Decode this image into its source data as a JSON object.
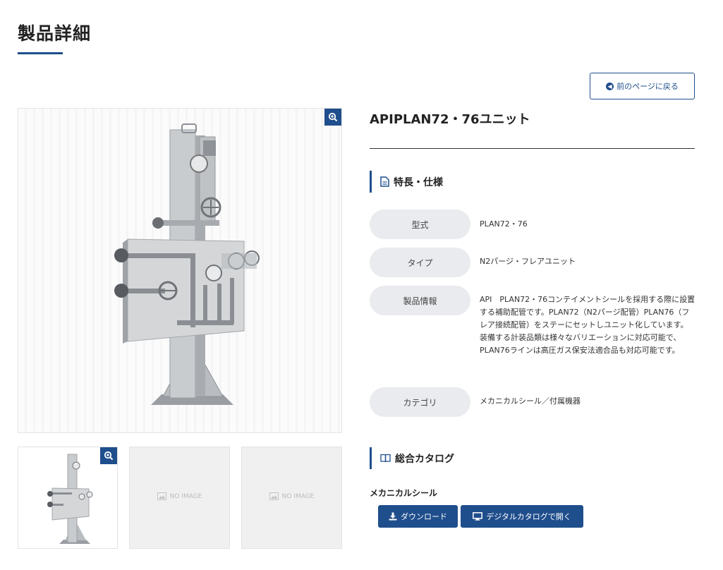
{
  "page": {
    "title": "製品詳細"
  },
  "back_button": {
    "label": "前のページに戻る"
  },
  "product": {
    "name": "APIPLAN72・76ユニット"
  },
  "thumbnails": {
    "no_image_label": "NO IMAGE"
  },
  "spec_section": {
    "heading": "特長・仕様",
    "rows": [
      {
        "label": "型式",
        "value": "PLAN72・76"
      },
      {
        "label": "タイプ",
        "value": "N2パージ・フレアユニット"
      },
      {
        "label": "製品情報",
        "value": "API　PLAN72・76コンテイメントシールを採用する際に設置する補助配管です。PLAN72（N2パージ配管）PLAN76（フレア接続配管）をステーにセットしユニット化しています。装備する計装品類は様々なバリエーションに対応可能で、PLAN76ラインは高圧ガス保安法適合品も対応可能です。"
      },
      {
        "label": "カテゴリ",
        "value": "メカニカルシール／付属機器"
      }
    ]
  },
  "catalog_section": {
    "heading": "総合カタログ",
    "subheading": "メカニカルシール",
    "download_label": "ダウンロード",
    "digital_label": "デジタルカタログで開く"
  },
  "colors": {
    "accent": "#1f4e8c",
    "label_bg": "#e9ebee"
  }
}
